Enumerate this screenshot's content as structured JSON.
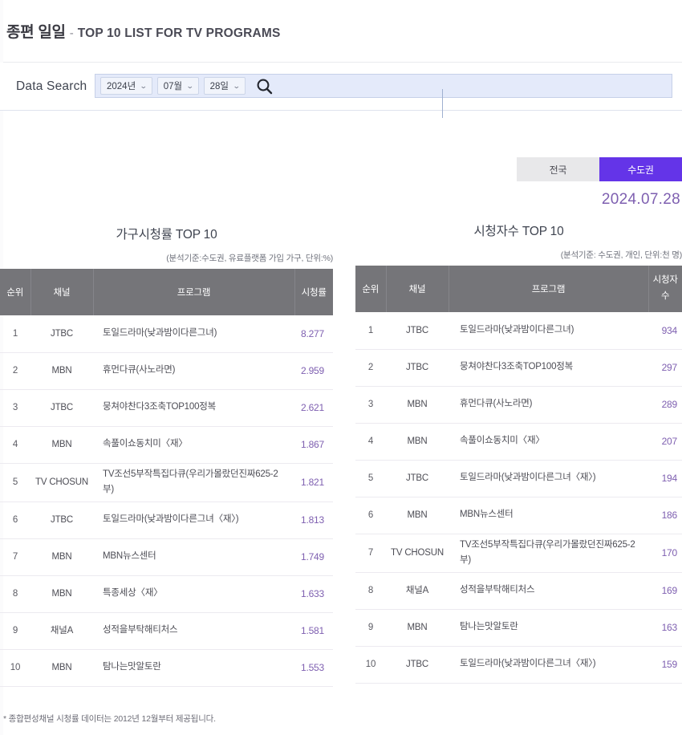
{
  "header": {
    "title_ko": "종편 일일",
    "dash": "-",
    "title_en": "TOP 10 LIST FOR TV PROGRAMS"
  },
  "search": {
    "label": "Data Search",
    "year": "2024년",
    "month": "07월",
    "day": "28일",
    "chevron": "⌄",
    "search_icon": "search-icon"
  },
  "region_toggle": {
    "nationwide": "전국",
    "metro": "수도권",
    "active": "수도권",
    "active_color": "#6434e8",
    "inactive_color": "#e8e8ea"
  },
  "date_display": "2024.07.28",
  "accent_color": "#7e5fb0",
  "footnote": "* 종합편성채널 시청률 데이터는 2012년 12월부터 제공됩니다.",
  "left_table": {
    "title": "가구시청률 TOP 10",
    "subtitle": "(분석기준:수도권, 유료플랫폼 가입 가구, 단위:%)",
    "columns": [
      "순위",
      "채널",
      "프로그램",
      "시청률"
    ],
    "rows": [
      {
        "rank": "1",
        "channel": "JTBC",
        "program": "토일드라마(낮과밤이다른그녀)",
        "value": "8.277"
      },
      {
        "rank": "2",
        "channel": "MBN",
        "program": "휴먼다큐(사노라면)",
        "value": "2.959"
      },
      {
        "rank": "3",
        "channel": "JTBC",
        "program": "뭉쳐야찬다3조축TOP100정복",
        "value": "2.621"
      },
      {
        "rank": "4",
        "channel": "MBN",
        "program": "속풀이쇼동치미〈재〉",
        "value": "1.867"
      },
      {
        "rank": "5",
        "channel": "TV CHOSUN",
        "program": "TV조선5부작특집다큐(우리가몰랐던진짜625-2부)",
        "value": "1.821"
      },
      {
        "rank": "6",
        "channel": "JTBC",
        "program": "토일드라마(낮과밤이다른그녀〈재〉)",
        "value": "1.813"
      },
      {
        "rank": "7",
        "channel": "MBN",
        "program": "MBN뉴스센터",
        "value": "1.749"
      },
      {
        "rank": "8",
        "channel": "MBN",
        "program": "특종세상〈재〉",
        "value": "1.633"
      },
      {
        "rank": "9",
        "channel": "채널A",
        "program": "성적을부탁해티처스",
        "value": "1.581"
      },
      {
        "rank": "10",
        "channel": "MBN",
        "program": "탐나는맛알토란",
        "value": "1.553"
      }
    ]
  },
  "right_table": {
    "title": "시청자수 TOP 10",
    "subtitle": "(분석기준: 수도권, 개인, 단위:천 명)",
    "columns": [
      "순위",
      "채널",
      "프로그램",
      "시청자 수"
    ],
    "rows": [
      {
        "rank": "1",
        "channel": "JTBC",
        "program": "토일드라마(낮과밤이다른그녀)",
        "value": "934"
      },
      {
        "rank": "2",
        "channel": "JTBC",
        "program": "뭉쳐야찬다3조축TOP100정복",
        "value": "297"
      },
      {
        "rank": "3",
        "channel": "MBN",
        "program": "휴먼다큐(사노라면)",
        "value": "289"
      },
      {
        "rank": "4",
        "channel": "MBN",
        "program": "속풀이쇼동치미〈재〉",
        "value": "207"
      },
      {
        "rank": "5",
        "channel": "JTBC",
        "program": "토일드라마(낮과밤이다른그녀〈재〉)",
        "value": "194"
      },
      {
        "rank": "6",
        "channel": "MBN",
        "program": "MBN뉴스센터",
        "value": "186"
      },
      {
        "rank": "7",
        "channel": "TV CHOSUN",
        "program": "TV조선5부작특집다큐(우리가몰랐던진짜625-2부)",
        "value": "170"
      },
      {
        "rank": "8",
        "channel": "채널A",
        "program": "성적을부탁해티처스",
        "value": "169"
      },
      {
        "rank": "9",
        "channel": "MBN",
        "program": "탐나는맛알토란",
        "value": "163"
      },
      {
        "rank": "10",
        "channel": "JTBC",
        "program": "토일드라마(낮과밤이다른그녀〈재〉)",
        "value": "159"
      }
    ]
  }
}
